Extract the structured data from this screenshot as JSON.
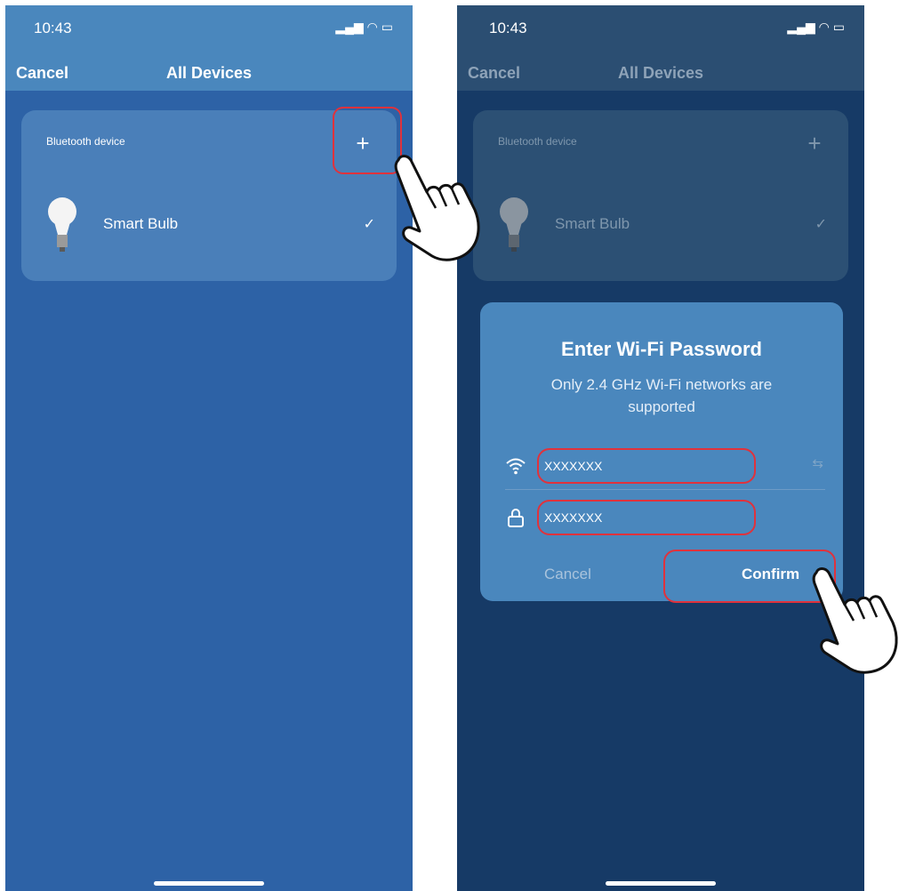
{
  "left_screen": {
    "status": {
      "time": "10:43"
    },
    "nav": {
      "cancel": "Cancel",
      "title": "All Devices"
    },
    "card": {
      "section_label": "Bluetooth device",
      "add": "+",
      "device_name": "Smart Bulb",
      "check": "✓"
    }
  },
  "right_screen": {
    "status": {
      "time": "10:43"
    },
    "nav": {
      "cancel": "Cancel",
      "title": "All Devices"
    },
    "card": {
      "section_label": "Bluetooth device",
      "add": "+",
      "device_name": "Smart Bulb",
      "check": "✓"
    },
    "dialog": {
      "title": "Enter Wi-Fi Password",
      "subtitle": "Only 2.4 GHz Wi-Fi networks are supported",
      "ssid_value": "XXXXXXX",
      "password_value": "XXXXXXX",
      "cancel": "Cancel",
      "confirm": "Confirm"
    }
  },
  "colors": {
    "left_background": "#2d62a6",
    "right_background": "#163a66",
    "dialog_background": "#4a87bd",
    "highlight": "#e0323c"
  }
}
